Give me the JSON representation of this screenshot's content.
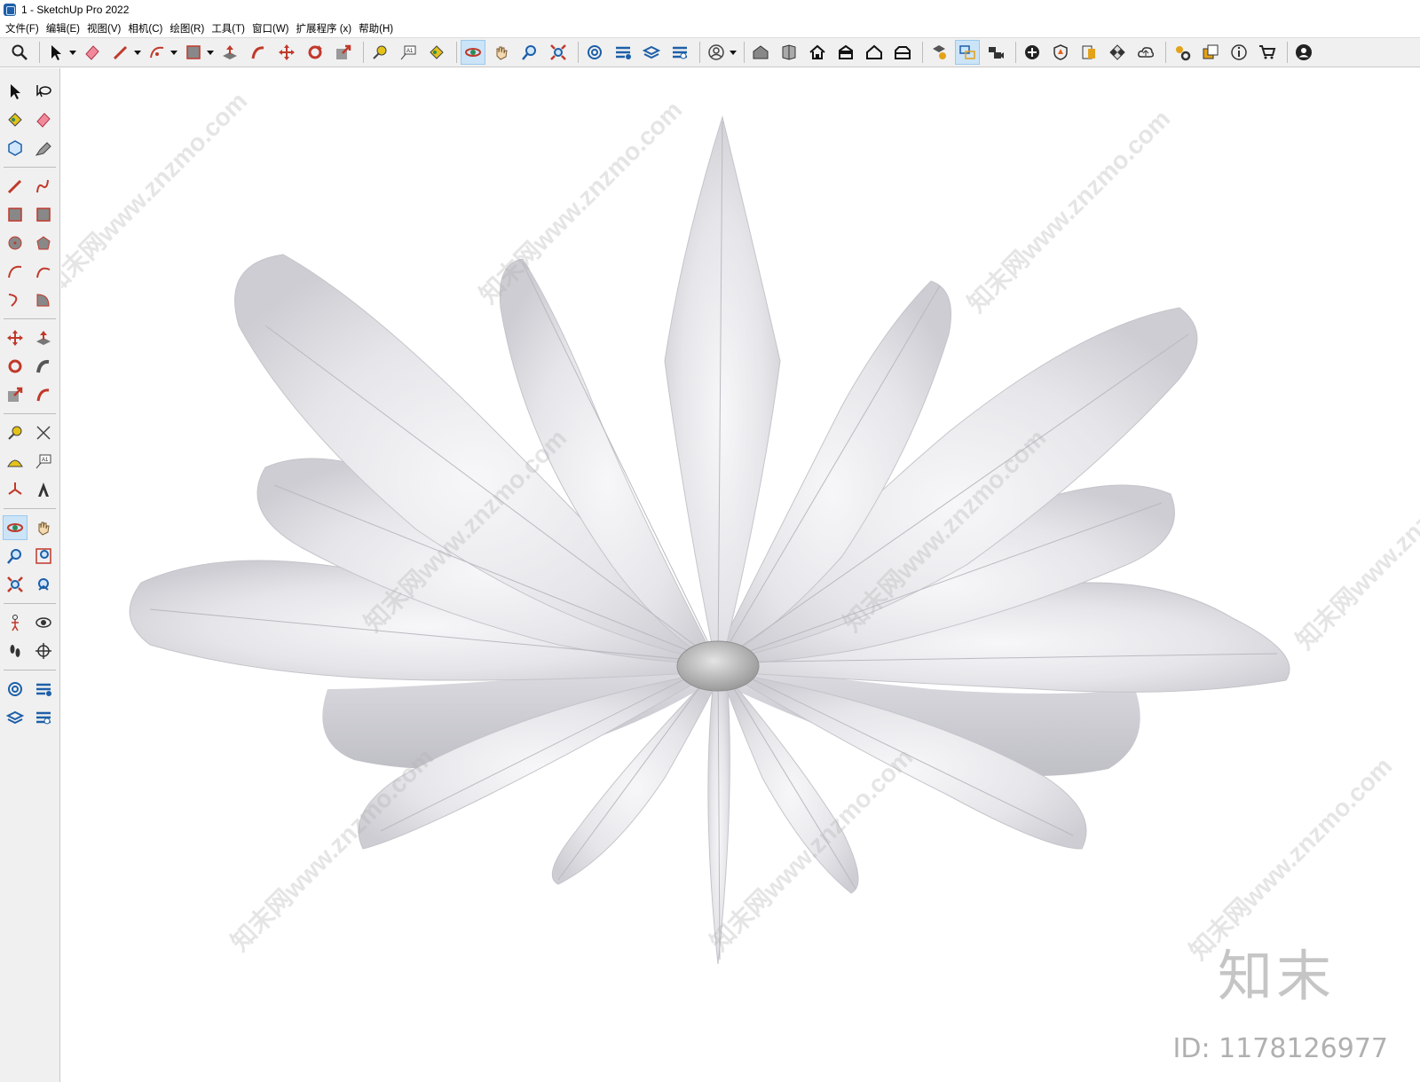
{
  "window": {
    "title": "1 - SketchUp Pro 2022"
  },
  "menu": [
    {
      "label": "文件(F)"
    },
    {
      "label": "编辑(E)"
    },
    {
      "label": "视图(V)"
    },
    {
      "label": "相机(C)"
    },
    {
      "label": "绘图(R)"
    },
    {
      "label": "工具(T)"
    },
    {
      "label": "窗口(W)"
    },
    {
      "label": "扩展程序 (x)"
    },
    {
      "label": "帮助(H)"
    }
  ],
  "toolbar_icons": [
    "zoom-icon",
    "select-icon",
    "eraser-icon",
    "pencil-icon",
    "arc-icon",
    "rectangle-icon",
    "push-pull-icon",
    "follow-me-icon",
    "move-icon",
    "rotate-icon",
    "scale-icon",
    "tape-measure-icon",
    "text-icon",
    "paint-bucket-icon",
    "orbit-icon",
    "pan-icon",
    "zoom-tool-icon",
    "zoom-extents-icon",
    "sandbox-icon",
    "classifier-icon",
    "layers-icon",
    "solid-tools-icon",
    "user-icon",
    "warehouse-icon",
    "components-icon",
    "home-icon",
    "front-view-icon",
    "house-outline-icon",
    "section-icon",
    "styles-icon",
    "scenes-icon",
    "camera-icon",
    "add-icon",
    "shield-icon",
    "materials-icon",
    "checker-icon",
    "cloud-icon",
    "settings-icon",
    "dialog-icon",
    "info-icon",
    "cart-icon",
    "account-icon"
  ],
  "watermark": {
    "text": "知末网www.znzmo.com"
  },
  "brand": {
    "logo": "知末",
    "id_text": "ID: 1178126977"
  },
  "colors": {
    "accent": "#1d5fa8",
    "active_bg": "#cce4f7",
    "model_fill": "#e6e6ea"
  }
}
